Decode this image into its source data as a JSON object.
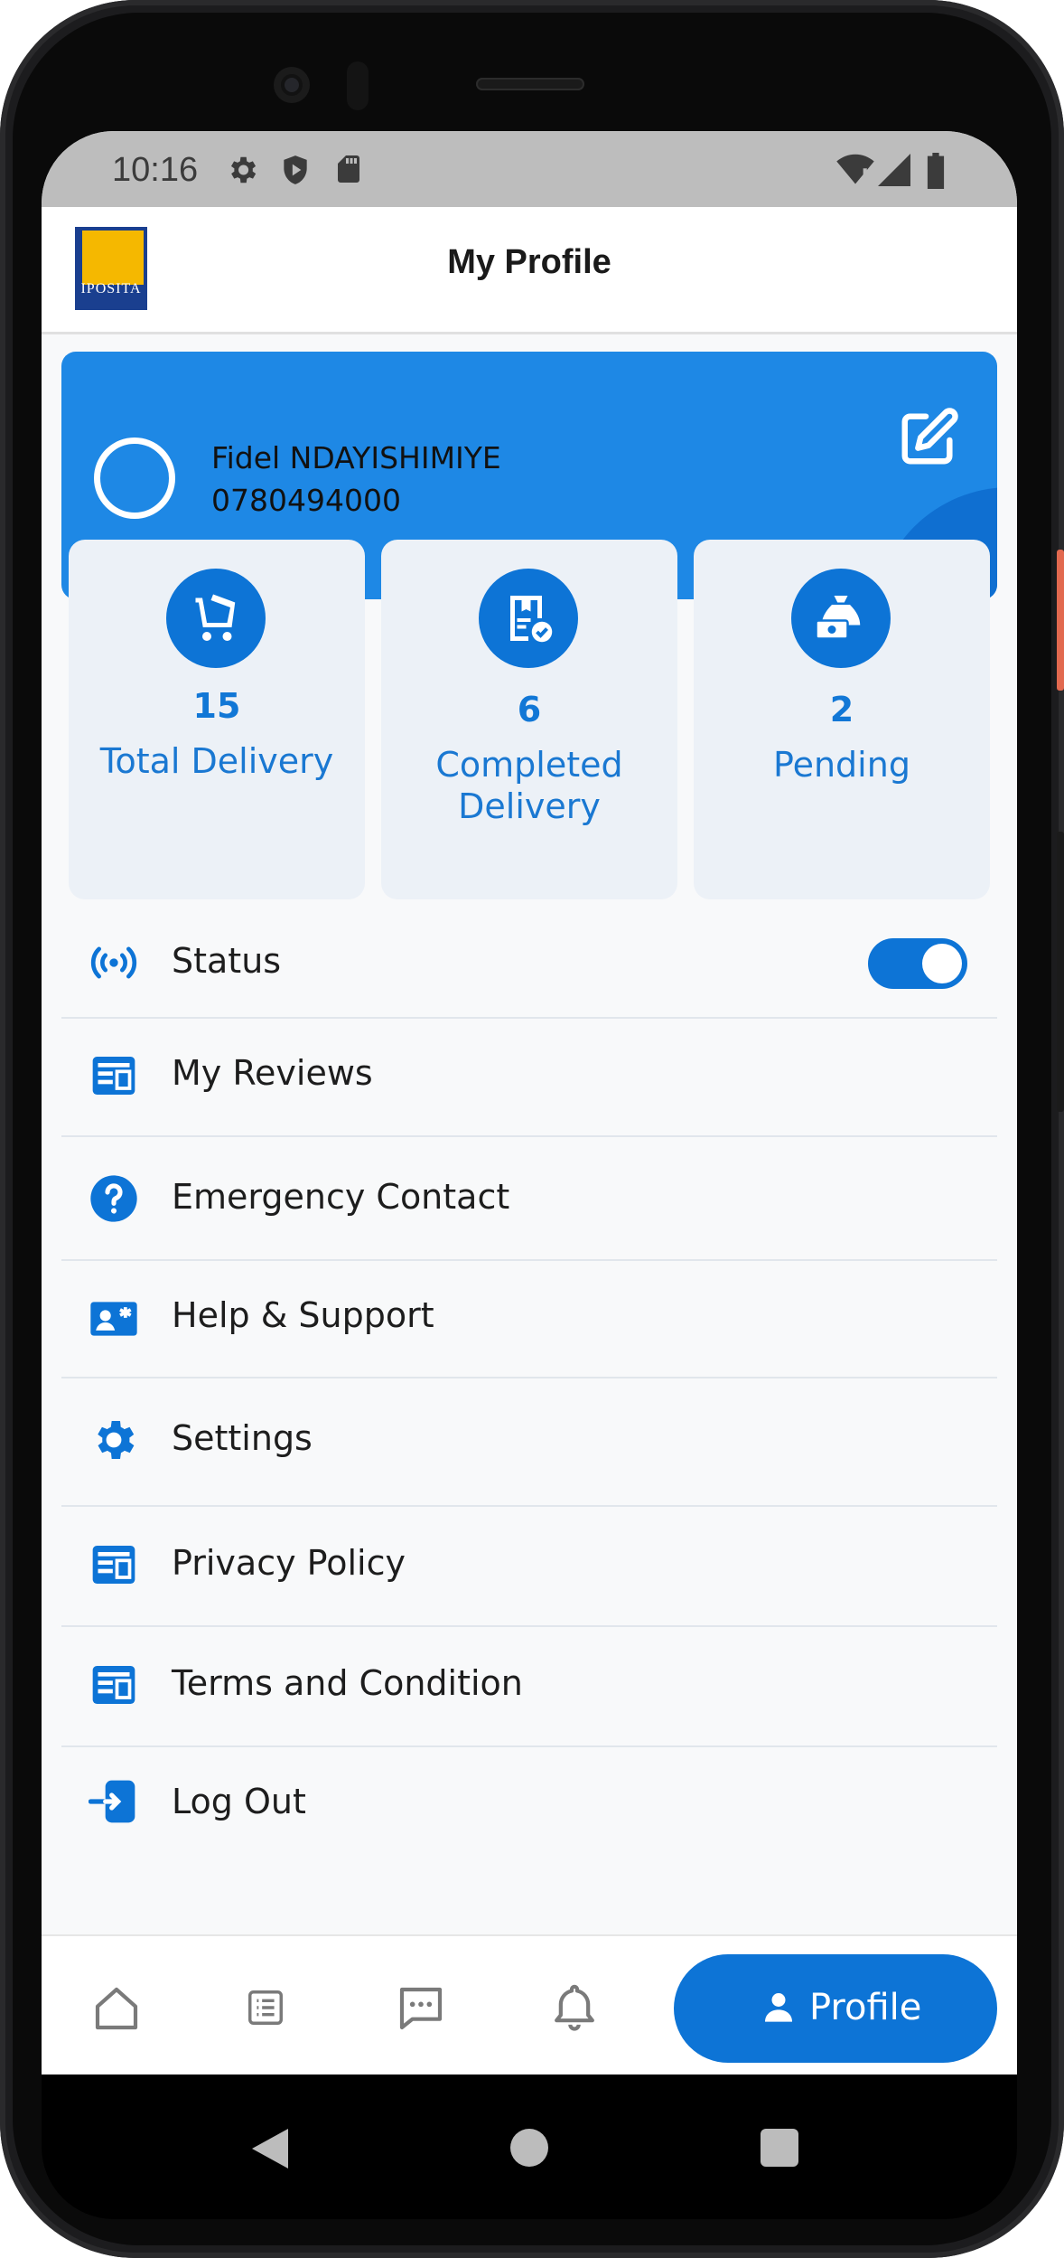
{
  "status_bar": {
    "time": "10:16"
  },
  "app_bar": {
    "title": "My Profile",
    "logo_text": "IPOSITA"
  },
  "profile": {
    "name": "Fidel NDAYISHIMIYE",
    "phone": "0780494000"
  },
  "stats": [
    {
      "value": "15",
      "label": "Total Delivery",
      "icon": "cart-icon"
    },
    {
      "value": "6",
      "label": "Completed Delivery",
      "icon": "package-check-icon"
    },
    {
      "value": "2",
      "label": "Pending",
      "icon": "money-bag-icon"
    }
  ],
  "menu": {
    "status": {
      "label": "Status",
      "toggle_on": true,
      "icon": "broadcast-icon"
    },
    "items": [
      {
        "label": "My Reviews",
        "icon": "dashboard-icon"
      },
      {
        "label": "Emergency Contact",
        "icon": "question-icon"
      },
      {
        "label": "Help & Support",
        "icon": "contact-card-icon"
      },
      {
        "label": "Settings",
        "icon": "gear-icon"
      },
      {
        "label": "Privacy Policy",
        "icon": "dashboard-icon"
      },
      {
        "label": "Terms and Condition",
        "icon": "dashboard-icon"
      },
      {
        "label": "Log Out",
        "icon": "logout-icon"
      }
    ]
  },
  "bottom_nav": {
    "items": [
      "home-icon",
      "list-icon",
      "chat-icon",
      "bell-icon"
    ],
    "active_label": "Profile"
  },
  "colors": {
    "primary": "#0d74d6",
    "card": "#1e88e5",
    "stat_bg": "#ecf1f7"
  }
}
